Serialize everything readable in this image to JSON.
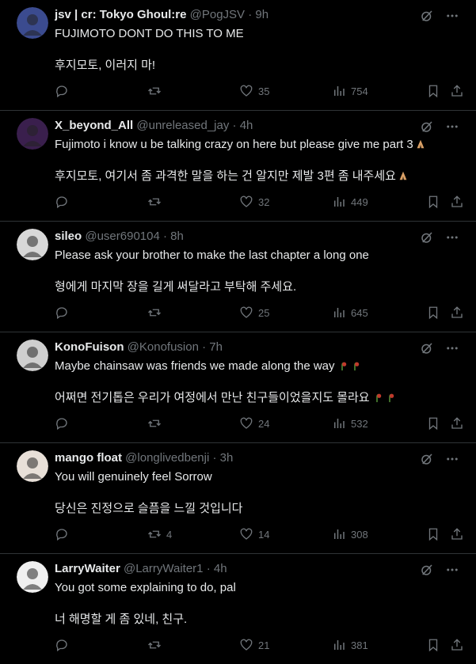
{
  "tweets": [
    {
      "name": "jsv | cr: Tokyo Ghoul:re",
      "handle": "@PogJSV",
      "time": "9h",
      "text": "FUJIMOTO DONT DO THIS TO ME",
      "translation": "후지모토, 이러지 마!",
      "replies": "",
      "retweets": "",
      "likes": "35",
      "views": "754",
      "avatar_color": "#3b4b8f",
      "emoji": ""
    },
    {
      "name": "X_beyond_All",
      "handle": "@unreleased_jay",
      "time": "4h",
      "text": "Fujimoto i know u be talking crazy on here but please give me part 3",
      "translation": "후지모토, 여기서 좀 과격한 말을 하는 건 알지만 제발 3편 좀 내주세요",
      "replies": "",
      "retweets": "",
      "likes": "32",
      "views": "449",
      "avatar_color": "#3a1f4d",
      "emoji": "pray"
    },
    {
      "name": "sileo",
      "handle": "@user690104",
      "time": "8h",
      "text": "Please ask your brother to make the last chapter a long one",
      "translation": "형에게 마지막 장을 길게 써달라고 부탁해 주세요.",
      "replies": "",
      "retweets": "",
      "likes": "25",
      "views": "645",
      "avatar_color": "#d8d8d8",
      "emoji": ""
    },
    {
      "name": "KonoFuison",
      "handle": "@Konofusion",
      "time": "7h",
      "text": "Maybe chainsaw was friends we made along the way",
      "translation": "어쩌면 전기톱은 우리가 여정에서 만난 친구들이었을지도 몰라요",
      "replies": "",
      "retweets": "",
      "likes": "24",
      "views": "532",
      "avatar_color": "#cfcfcf",
      "emoji": "wilted"
    },
    {
      "name": "mango float",
      "handle": "@longlivedbenji",
      "time": "3h",
      "text": "You will genuinely feel Sorrow",
      "translation": "당신은 진정으로 슬픔을 느낄 것입니다",
      "replies": "",
      "retweets": "4",
      "likes": "14",
      "views": "308",
      "avatar_color": "#e8e0d8",
      "emoji": ""
    },
    {
      "name": "LarryWaiter",
      "handle": "@LarryWaiter1",
      "time": "4h",
      "text": "You got some explaining to do, pal",
      "translation": "너 해명할 게 좀 있네, 친구.",
      "replies": "",
      "retweets": "",
      "likes": "21",
      "views": "381",
      "avatar_color": "#f0f0f0",
      "emoji": ""
    }
  ]
}
